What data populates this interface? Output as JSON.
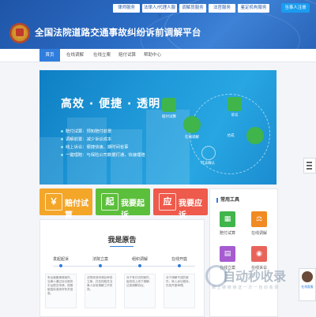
{
  "header": {
    "site_title": "全国法院道路交通事故纠纷诉前调解平台",
    "top_links": [
      "律师服务",
      "法律人/代理人服务",
      "调解员服务",
      "法官服务",
      "鉴定机构服务"
    ],
    "login_label": "当事人注册"
  },
  "nav": {
    "items": [
      "首页",
      "在线调解",
      "在线立案",
      "赔付试算",
      "帮助中心"
    ],
    "active": "首页"
  },
  "banner": {
    "slogan": "高效 · 便捷 · 透明",
    "features": [
      "赔付试算：预知赔付前景",
      "调解前置：减少诉讼成本",
      "线上诉讼：便捷快速、期时间省事",
      "一键理赔：与保险公司数据打通，快速理赔"
    ],
    "hub_labels": [
      "赔付试算",
      "在线调解",
      "诉讼",
      "达成",
      "司法确认"
    ]
  },
  "actions": [
    {
      "glyph": "￥",
      "label": "赔付试算",
      "color": "#f4a629"
    },
    {
      "glyph": "起",
      "label": "我要起诉",
      "color": "#5cbf3b"
    },
    {
      "glyph": "应",
      "label": "我要应诉",
      "color": "#ee5a4b"
    }
  ],
  "process": {
    "title": "我是原告",
    "steps": [
      "发起起诉",
      "法院立案",
      "组织调解",
      "在线开庭"
    ],
    "step_texts": [
      "来台道路事故案件，当事人通过诉讼服务平台提交申请，按照赔偿标准填写有关信息。",
      "法院收到申请后审查立案，并告知相关当事人诉前调解工作安排。",
      "对于有共识的案件，组织线上线下调解，达成调解协议。",
      "对于调解不成的案件，转入诉讼程序，在线开庭审理。"
    ]
  },
  "tools": {
    "title": "常用工具",
    "items": [
      {
        "label": "赔付试算",
        "color": "#3fb54b",
        "icon": "calculator-icon"
      },
      {
        "label": "在线调解",
        "color": "#f08a23",
        "icon": "gavel-icon"
      },
      {
        "label": "在线立案",
        "color": "#a65bd0",
        "icon": "document-icon"
      },
      {
        "label": "在线诉讼",
        "color": "#e8645a",
        "icon": "court-icon"
      }
    ]
  },
  "watermark": {
    "text": "自动秒收录",
    "sub": "做 上 链 链 接 送 一 次 一 自 动 收 录"
  },
  "service": {
    "label": "在线客服"
  }
}
